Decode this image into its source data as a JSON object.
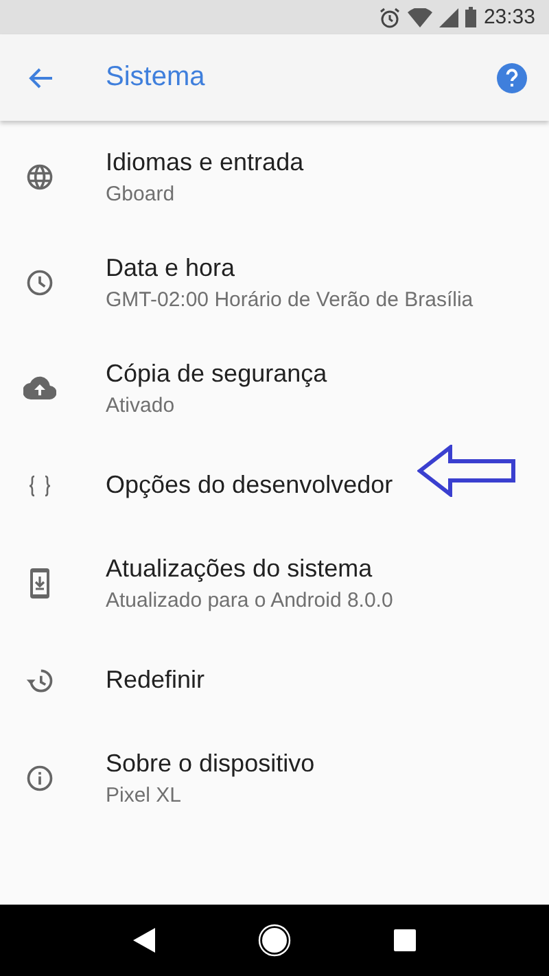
{
  "status_bar": {
    "time": "23:33"
  },
  "toolbar": {
    "title": "Sistema"
  },
  "items": [
    {
      "title": "Idiomas e entrada",
      "subtitle": "Gboard"
    },
    {
      "title": "Data e hora",
      "subtitle": "GMT-02:00 Horário de Verão de Brasília"
    },
    {
      "title": "Cópia de segurança",
      "subtitle": "Ativado"
    },
    {
      "title": "Opções do desenvolvedor"
    },
    {
      "title": "Atualizações do sistema",
      "subtitle": "Atualizado para o Android 8.0.0"
    },
    {
      "title": "Redefinir"
    },
    {
      "title": "Sobre o dispositivo",
      "subtitle": "Pixel XL"
    }
  ]
}
